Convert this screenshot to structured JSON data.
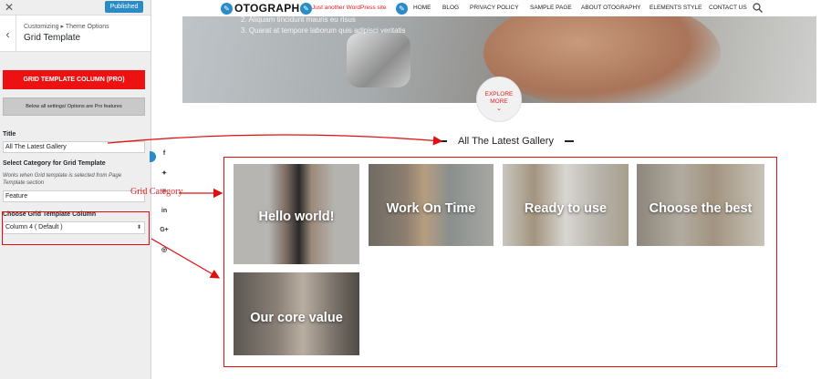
{
  "sidebar": {
    "publish_label": "Published",
    "breadcrumb": "Customizing ▸ Theme Options",
    "section_title": "Grid Template",
    "pro_button_label": "GRID TEMPLATE COLUMN (PRO)",
    "pro_note_label": "Below all settings/ Options are Pro features",
    "title_label": "Title",
    "title_value": "All The Latest Gallery",
    "category_label": "Select Category for Grid Template",
    "category_note": "Works when Grid template is selected from Page Template section",
    "category_value": "Feature",
    "column_label": "Choose Grid Template Column",
    "column_value": "Column 4 ( Default )"
  },
  "site": {
    "logo_text": "OTOGRAPH",
    "tagline": "Just another WordPress site",
    "nav": [
      "HOME",
      "BLOG",
      "PRIVACY POLICY",
      "SAMPLE PAGE",
      "ABOUT OTOGRAPHY",
      "ELEMENTS STYLE",
      "CONTACT US"
    ],
    "hero_lines": [
      "2. Aliquam tincidunt mauris eu risus",
      "3. Quarat at tempore laborum quis adipisci veritatis"
    ],
    "explore_line1": "EXPLORE",
    "explore_line2": "MORE",
    "gallery_title": "All The Latest Gallery",
    "cards": [
      {
        "title": "Hello world!"
      },
      {
        "title": "Work On Time"
      },
      {
        "title": "Ready to use"
      },
      {
        "title": "Choose the best"
      },
      {
        "title": "Our core value"
      }
    ]
  },
  "annotation": {
    "grid_category": "Grid Category"
  },
  "colors": {
    "accent_red": "#e01010",
    "wp_blue": "#2a8bc6"
  },
  "icons": [
    "close-icon",
    "back-chevron-icon",
    "pencil-icon",
    "search-icon",
    "facebook-icon",
    "twitter-icon",
    "pinterest-icon",
    "linkedin-icon",
    "google-plus-icon",
    "instagram-icon"
  ]
}
